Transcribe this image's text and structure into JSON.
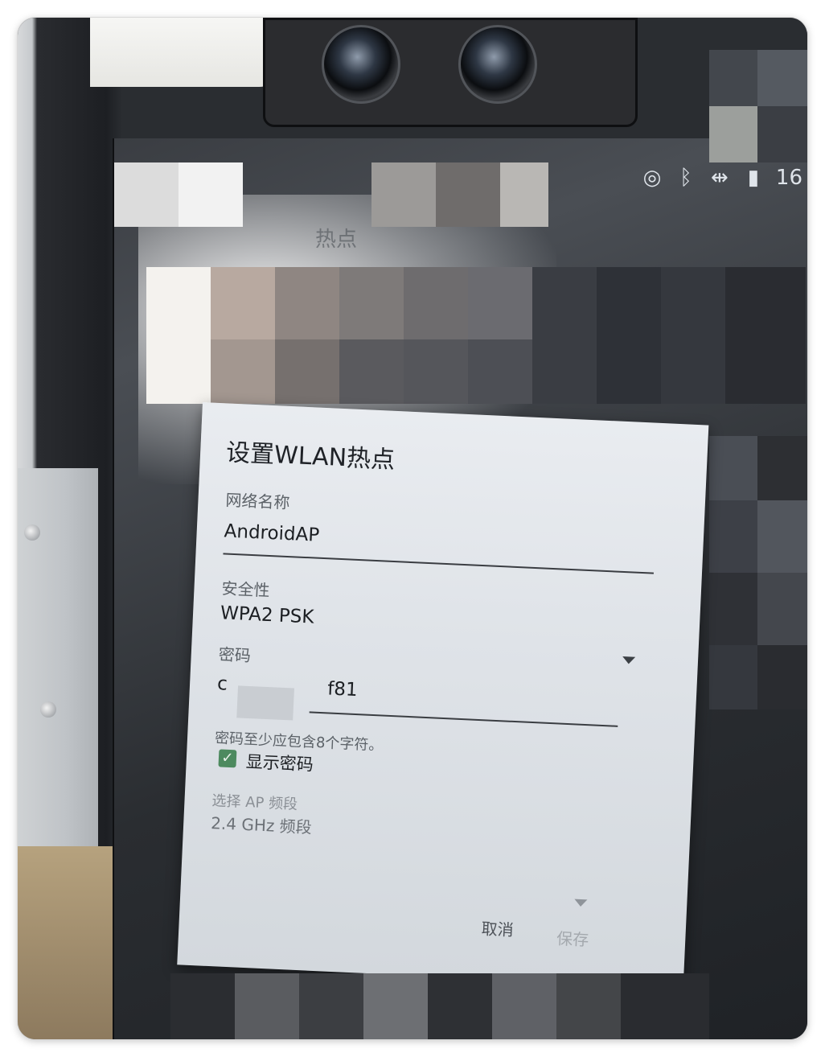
{
  "status_bar": {
    "icons": [
      "hotspot-icon",
      "bluetooth-icon",
      "data-transfer-icon",
      "battery-charging-icon"
    ],
    "clock_partial": "16"
  },
  "background": {
    "title_partial": "热点"
  },
  "dialog": {
    "title": "设置WLAN热点",
    "network_name_label": "网络名称",
    "network_name_value": "AndroidAP",
    "security_label": "安全性",
    "security_value": "WPA2 PSK",
    "password_label": "密码",
    "password_value_prefix": "c",
    "password_value_suffix": "f81",
    "password_hint": "密码至少应包含8个字符。",
    "show_password_label": "显示密码",
    "show_password_checked": true,
    "ap_band_label": "选择 AP 频段",
    "ap_band_value": "2.4 GHz 频段",
    "cancel_label": "取消",
    "save_label": "保存"
  },
  "colors": {
    "checkbox_accent": "#4d8a5f",
    "dialog_background": "#e3e7eb"
  }
}
